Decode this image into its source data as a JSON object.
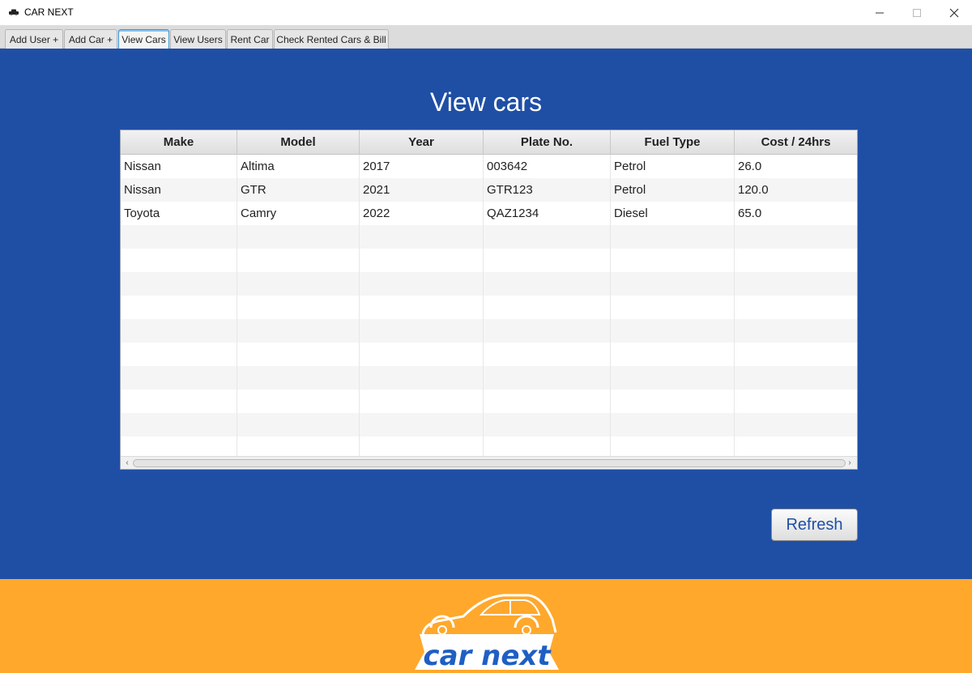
{
  "window": {
    "title": "CAR NEXT",
    "icon": "car-icon",
    "controls": [
      "minimize-icon",
      "maximize-icon",
      "close-icon"
    ]
  },
  "tabs": [
    {
      "label": "Add User +",
      "active": false
    },
    {
      "label": "Add Car +",
      "active": false
    },
    {
      "label": "View Cars",
      "active": true
    },
    {
      "label": "View Users",
      "active": false
    },
    {
      "label": "Rent Car",
      "active": false
    },
    {
      "label": "Check Rented Cars & Bill",
      "active": false
    }
  ],
  "main": {
    "heading": "View cars",
    "table": {
      "columns": [
        "Make",
        "Model",
        "Year",
        "Plate No.",
        "Fuel Type",
        "Cost / 24hrs"
      ],
      "rows": [
        [
          "Nissan",
          "Altima",
          "2017",
          "003642",
          "Petrol",
          "26.0"
        ],
        [
          "Nissan",
          "GTR",
          "2021",
          "GTR123",
          "Petrol",
          "120.0"
        ],
        [
          "Toyota",
          "Camry",
          "2022",
          "QAZ1234",
          "Diesel",
          "65.0"
        ]
      ]
    },
    "refresh_label": "Refresh"
  },
  "footer": {
    "logo_text": "car next"
  },
  "colors": {
    "main_bg": "#1f4fa5",
    "footer_bg": "#ffa82c",
    "logo_text": "#1f5fc4"
  }
}
